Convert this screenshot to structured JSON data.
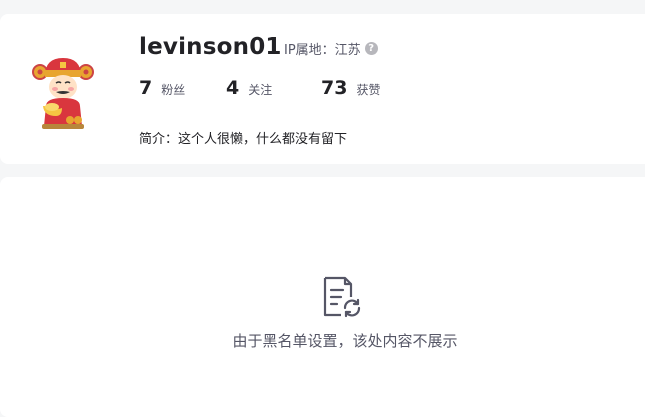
{
  "profile": {
    "username": "levinson01",
    "ip_location": "IP属地：江苏",
    "help_icon": "?",
    "avatar_icon": "caishen-avatar-icon",
    "stats": [
      {
        "value": "7",
        "label": "粉丝"
      },
      {
        "value": "4",
        "label": "关注"
      },
      {
        "value": "73",
        "label": "获赞"
      }
    ],
    "intro": "简介：这个人很懒，什么都没有留下"
  },
  "content": {
    "empty_icon": "document-refresh-icon",
    "empty_message": "由于黑名单设置，该处内容不展示"
  },
  "colors": {
    "background": "#f5f6f7",
    "card": "#ffffff",
    "text_primary": "#222226",
    "text_secondary": "#555666",
    "icon_gray": "#b7b7bc"
  }
}
